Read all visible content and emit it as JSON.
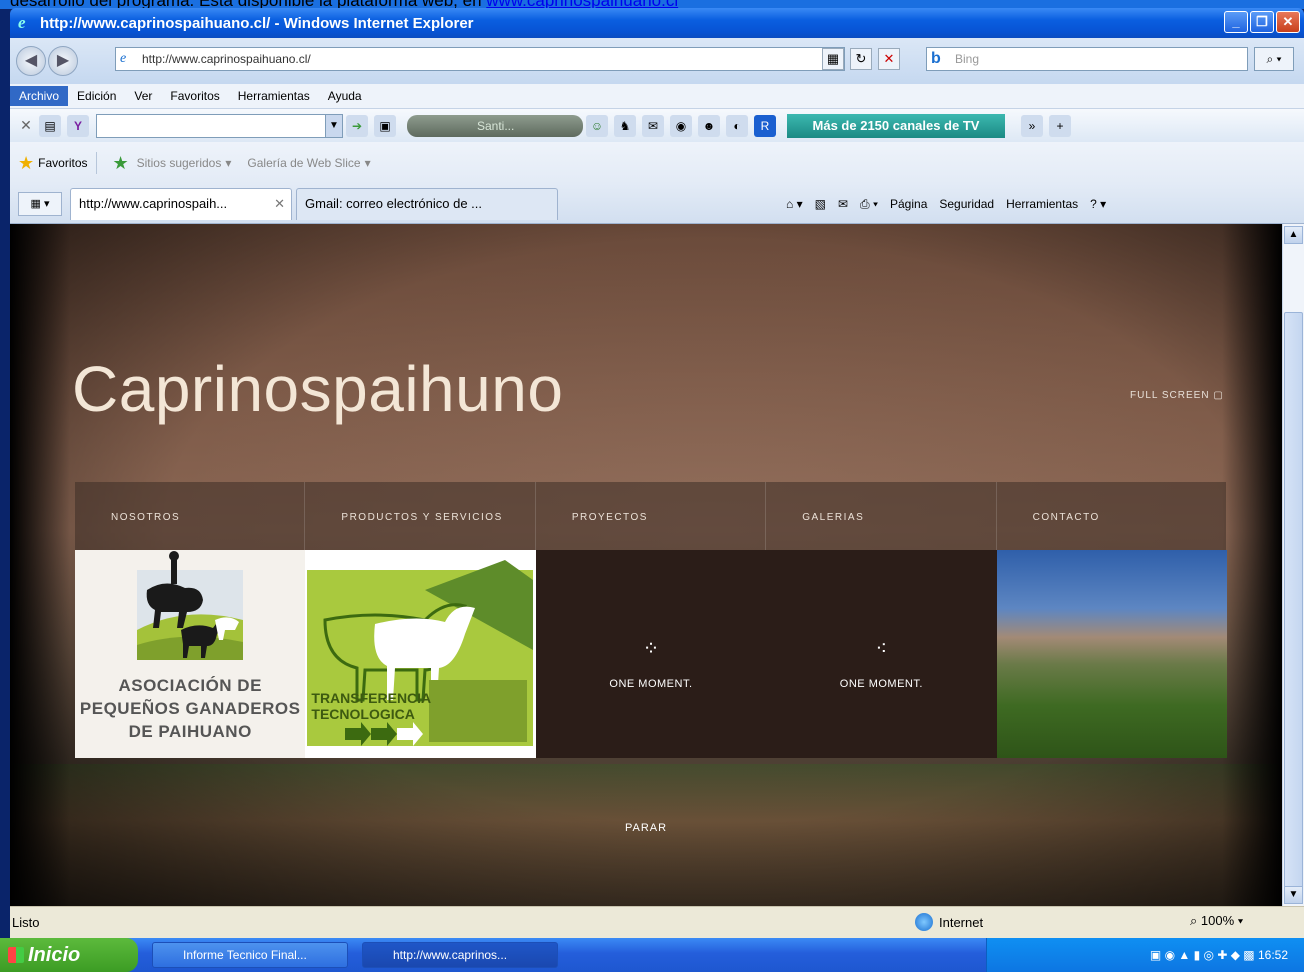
{
  "top_caption": {
    "text": "desarrollo del programa. Esta disponible la plataforma web, en",
    "link": "www.caprinospaihuano.cl"
  },
  "window": {
    "title": "http://www.caprinospaihuano.cl/ - Windows Internet Explorer"
  },
  "address_bar": {
    "url": "http://www.caprinospaihuano.cl/",
    "search_placeholder": "Bing"
  },
  "menu": [
    "Archivo",
    "Edición",
    "Ver",
    "Favoritos",
    "Herramientas",
    "Ayuda"
  ],
  "toolbar": {
    "radio_label": "Santi...",
    "tv_button": "Más de 2150 canales de TV"
  },
  "favorites_bar": {
    "favorites": "Favoritos",
    "suggested": "Sitios sugeridos",
    "slice": "Galería de Web Slice"
  },
  "tabs": [
    {
      "label": "http://www.caprinospaih..."
    },
    {
      "label": "Gmail: correo electrónico de ..."
    }
  ],
  "command_bar": [
    "Página",
    "Seguridad",
    "Herramientas"
  ],
  "site": {
    "title": "Caprinospaihuno",
    "fullscreen": "FULL SCREEN",
    "nav": [
      "NOSOTROS",
      "PRODUCTOS Y SERVICIOS",
      "PROYECTOS",
      "GALERIAS",
      "CONTACTO"
    ],
    "tile1_text": "ASOCIACIÓN DE PEQUEÑOS GANADEROS DE PAIHUANO",
    "tile2_text": "TRANSFERENCIA TECNOLOGICA",
    "loading": "ONE MOMENT.",
    "parar": "PARAR"
  },
  "status": {
    "text": "Listo",
    "zone": "Internet",
    "zoom": "100%"
  },
  "taskbar": {
    "start": "Inicio",
    "items": [
      "Informe Tecnico Final...",
      "http://www.caprinos..."
    ],
    "clock": "16:52"
  }
}
